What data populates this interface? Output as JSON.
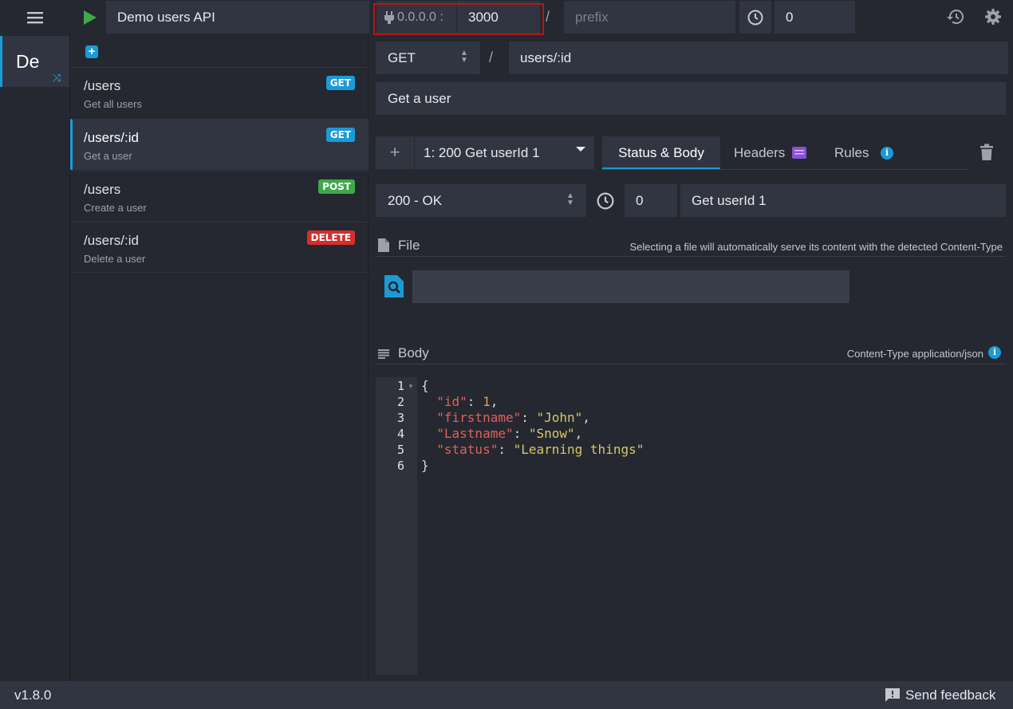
{
  "topbar": {
    "environment_name": "Demo users API",
    "host_label": "0.0.0.0 :",
    "port": "3000",
    "slash": "/",
    "prefix_placeholder": "prefix",
    "latency": "0"
  },
  "environments": [
    {
      "label": "De"
    }
  ],
  "routes": [
    {
      "path": "/users",
      "description": "Get all users",
      "method": "GET",
      "active": false
    },
    {
      "path": "/users/:id",
      "description": "Get a user",
      "method": "GET",
      "active": true
    },
    {
      "path": "/users",
      "description": "Create a user",
      "method": "POST",
      "active": false
    },
    {
      "path": "/users/:id",
      "description": "Delete a user",
      "method": "DELETE",
      "active": false
    }
  ],
  "route_editor": {
    "method": "GET",
    "slash": "/",
    "endpoint": "users/:id",
    "documentation": "Get a user"
  },
  "response": {
    "add_label": "+",
    "selected": "1: 200  Get userId 1",
    "tabs": {
      "status_body": "Status & Body",
      "headers": "Headers",
      "rules": "Rules"
    },
    "status": "200 - OK",
    "latency": "0",
    "label": "Get userId 1",
    "file_title": "File",
    "file_hint": "Selecting a file will automatically serve its content with the detected Content-Type",
    "body_title": "Body",
    "content_type": "Content-Type application/json"
  },
  "editor": {
    "line_numbers": [
      "1",
      "2",
      "3",
      "4",
      "5",
      "6"
    ]
  },
  "footer": {
    "version": "v1.8.0",
    "feedback": "Send feedback"
  },
  "colors": {
    "accent": "#1a9bd8",
    "get": "#1a9bd8",
    "post": "#3da94a",
    "delete": "#d62e2e",
    "run": "#3da94a",
    "highlight_box": "#b01818"
  }
}
